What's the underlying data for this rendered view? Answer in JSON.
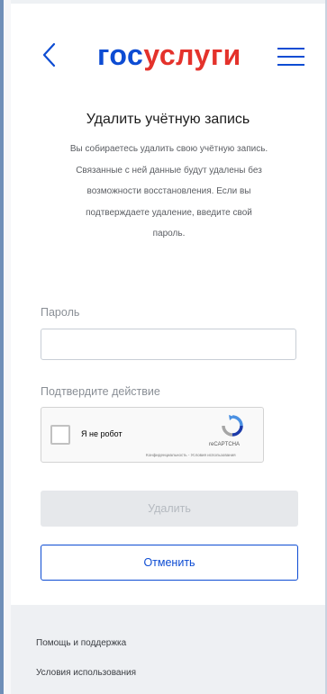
{
  "header": {
    "logo_part1": "гос",
    "logo_part2": "услуги",
    "back_icon": "chevron-left-icon",
    "menu_icon": "hamburger-menu-icon"
  },
  "main": {
    "title": "Удалить учётную запись",
    "description": [
      "Вы собираетесь удалить свою учётную запись.",
      "Связанные с ней данные будут удалены без",
      "возможности восстановления. Если вы",
      "подтверждаете удаление, введите свой",
      "пароль."
    ],
    "password_label": "Пароль",
    "password_value": "",
    "confirm_label": "Подтвердите действие",
    "captcha": {
      "checkbox_label": "Я не робот",
      "brand": "reCAPTCHA",
      "links": "Конфиденциальность - Условия использования",
      "icon": "recaptcha-icon"
    },
    "delete_button": "Удалить",
    "cancel_button": "Отменить"
  },
  "footer": {
    "links": [
      "Помощь и поддержка",
      "Условия использования"
    ]
  },
  "colors": {
    "brand_blue": "#0d4cd3",
    "brand_red": "#e4322b",
    "footer_bg": "#eef0f3"
  }
}
